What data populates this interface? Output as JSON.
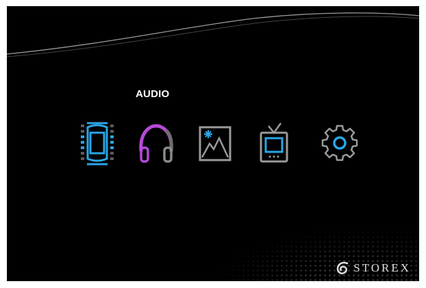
{
  "menu": {
    "selected_label": "AUDIO",
    "items": [
      {
        "id": "video",
        "icon": "film-strip-icon",
        "color": "#2aa6e8"
      },
      {
        "id": "audio",
        "icon": "headphones-icon",
        "color": "#b44ad8",
        "selected": true
      },
      {
        "id": "photo",
        "icon": "photo-icon",
        "color": "#9a9a9a"
      },
      {
        "id": "tv",
        "icon": "tv-icon",
        "color": "#9a9a9a"
      },
      {
        "id": "settings",
        "icon": "gear-icon",
        "color": "#9a9a9a"
      }
    ]
  },
  "brand": {
    "name": "STOREX",
    "logo_icon": "storex-logo-icon"
  },
  "colors": {
    "background": "#000000",
    "accent_blue": "#2aa6e8",
    "accent_purple": "#b44ad8",
    "icon_gray": "#9a9a9a"
  }
}
